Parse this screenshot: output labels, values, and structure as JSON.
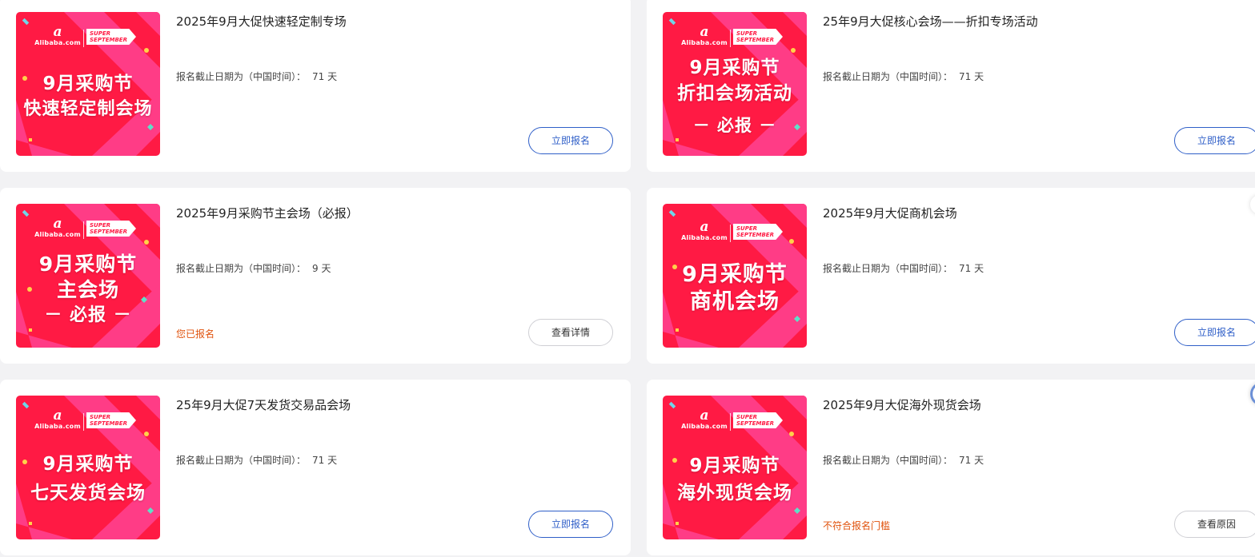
{
  "colors": {
    "banner_red": "#ff1a44",
    "banner_stripe": "#ff3c86",
    "primary_blue": "#2f5fc8",
    "status_orange": "#e0520c"
  },
  "banner_logo": {
    "alibaba_mark": "a",
    "alibaba_word": "Alibaba.com",
    "super_line1": "SUPER",
    "super_line2": "SEPTEMBER"
  },
  "cards": [
    {
      "title": "2025年9月大促快速轻定制专场",
      "deadline_label": "报名截止日期为（中国时间）：",
      "deadline_value": "71 天",
      "banner_lines": [
        "9月采购节",
        "快速轻定制会场"
      ],
      "status": "",
      "button": "立即报名"
    },
    {
      "title": "25年9月大促核心会场——折扣专场活动",
      "deadline_label": "报名截止日期为（中国时间）：",
      "deadline_value": "71 天",
      "banner_lines": [
        "9月采购节",
        "折扣会场活动",
        "－ 必报 －"
      ],
      "status": "",
      "button": "立即报名"
    },
    {
      "title": "2025年9月采购节主会场（必报）",
      "deadline_label": "报名截止日期为（中国时间）：",
      "deadline_value": "9 天",
      "banner_lines": [
        "9月采购节",
        "主会场",
        "－ 必报 －"
      ],
      "status": "您已报名",
      "button": "查看详情"
    },
    {
      "title": "2025年9月大促商机会场",
      "deadline_label": "报名截止日期为（中国时间）：",
      "deadline_value": "71 天",
      "banner_lines": [
        "9月采购节",
        "商机会场"
      ],
      "status": "",
      "button": "立即报名"
    },
    {
      "title": "25年9月大促7天发货交易品会场",
      "deadline_label": "报名截止日期为（中国时间）：",
      "deadline_value": "71 天",
      "banner_lines": [
        "9月采购节",
        "七天发货会场"
      ],
      "status": "",
      "button": "立即报名"
    },
    {
      "title": "2025年9月大促海外现货会场",
      "deadline_label": "报名截止日期为（中国时间）：",
      "deadline_value": "71 天",
      "banner_lines": [
        "9月采购节",
        "海外现货会场"
      ],
      "status": "不符合报名门槛",
      "button": "查看原因"
    }
  ]
}
